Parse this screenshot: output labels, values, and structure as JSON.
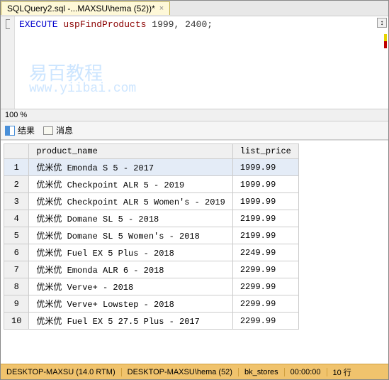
{
  "tab": {
    "title": "SQLQuery2.sql -...MAXSU\\hema (52))*",
    "close": "×"
  },
  "editor": {
    "keyword": "EXECUTE",
    "proc": "uspFindProducts",
    "args": "1999, 2400;"
  },
  "watermark": {
    "line1": "易百教程",
    "line2": "www.yiibai.com"
  },
  "zoom": "100 %",
  "result_tabs": {
    "results": "结果",
    "messages": "消息"
  },
  "columns": {
    "c1": "product_name",
    "c2": "list_price"
  },
  "rows": [
    {
      "n": "1",
      "name": "优米优 Emonda S 5 - 2017",
      "price": "1999.99"
    },
    {
      "n": "2",
      "name": "优米优 Checkpoint ALR 5 - 2019",
      "price": "1999.99"
    },
    {
      "n": "3",
      "name": "优米优 Checkpoint ALR 5 Women's - 2019",
      "price": "1999.99"
    },
    {
      "n": "4",
      "name": "优米优 Domane SL 5 - 2018",
      "price": "2199.99"
    },
    {
      "n": "5",
      "name": "优米优 Domane SL 5 Women's - 2018",
      "price": "2199.99"
    },
    {
      "n": "6",
      "name": "优米优 Fuel EX 5 Plus - 2018",
      "price": "2249.99"
    },
    {
      "n": "7",
      "name": "优米优 Emonda ALR 6 - 2018",
      "price": "2299.99"
    },
    {
      "n": "8",
      "name": "优米优 Verve+ - 2018",
      "price": "2299.99"
    },
    {
      "n": "9",
      "name": "优米优 Verve+ Lowstep - 2018",
      "price": "2299.99"
    },
    {
      "n": "10",
      "name": "优米优 Fuel EX 5 27.5 Plus - 2017",
      "price": "2299.99"
    }
  ],
  "status": {
    "server": "DESKTOP-MAXSU (14.0 RTM)",
    "user": "DESKTOP-MAXSU\\hema (52)",
    "db": "bk_stores",
    "time": "00:00:00",
    "rows": "10 行"
  }
}
